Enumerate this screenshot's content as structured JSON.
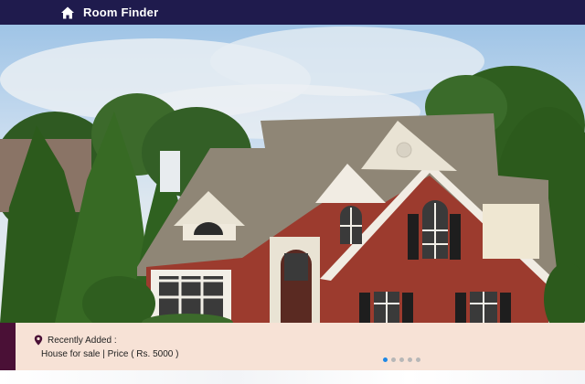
{
  "navbar": {
    "brand": "Room Finder",
    "icon": "home-icon",
    "background": "#1f1b4d"
  },
  "hero": {
    "image": "house-photo",
    "description_icon": "house-image"
  },
  "info": {
    "heading": "Recently Added :",
    "detail": "House for sale  | Price ( Rs. 5000 )",
    "icon": "location-pin-icon",
    "accent_color": "#4a1036",
    "background": "#f7e2d6"
  },
  "carousel": {
    "slides_count": 5,
    "active_index": 0,
    "active_color": "#1e88e5"
  }
}
